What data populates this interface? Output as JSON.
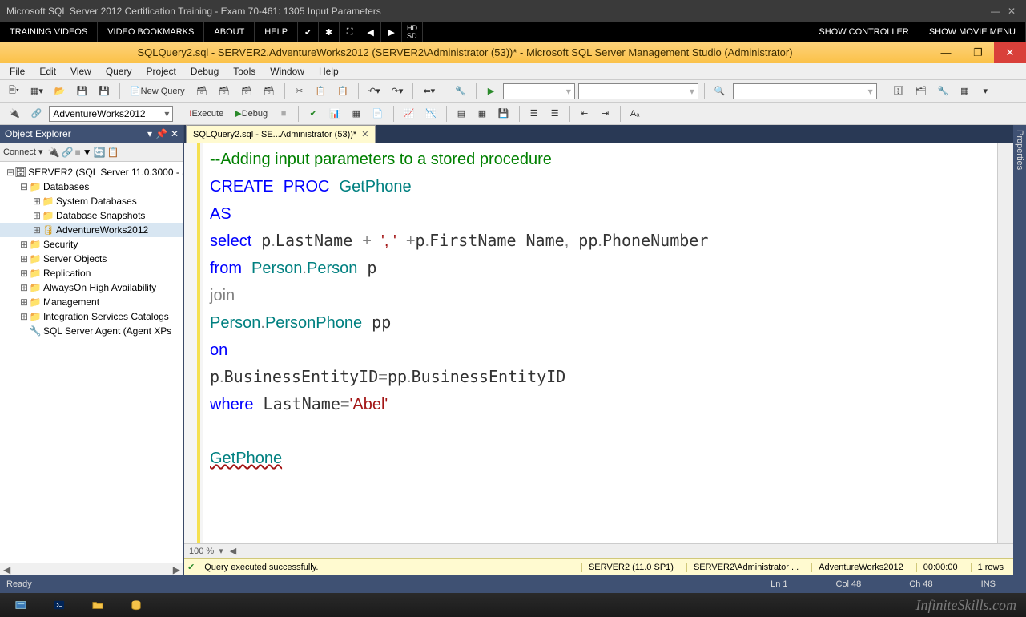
{
  "outerWindow": {
    "title": "Microsoft SQL Server 2012 Certification Training - Exam 70-461: 1305 Input Parameters"
  },
  "trainingBar": {
    "buttons": [
      "TRAINING VIDEOS",
      "VIDEO BOOKMARKS",
      "ABOUT",
      "HELP"
    ],
    "rightButtons": [
      "SHOW CONTROLLER",
      "SHOW MOVIE MENU"
    ]
  },
  "ssmsTitle": "SQLQuery2.sql - SERVER2.AdventureWorks2012 (SERVER2\\Administrator (53))* - Microsoft SQL Server Management Studio (Administrator)",
  "menuBar": [
    "File",
    "Edit",
    "View",
    "Query",
    "Project",
    "Debug",
    "Tools",
    "Window",
    "Help"
  ],
  "toolbar1": {
    "newQuery": "New Query"
  },
  "toolbar2": {
    "dbCombo": "AdventureWorks2012",
    "execute": "Execute",
    "debug": "Debug"
  },
  "objectExplorer": {
    "title": "Object Explorer",
    "connectLabel": "Connect ▾",
    "tree": {
      "server": "SERVER2 (SQL Server 11.0.3000 - S",
      "databases": "Databases",
      "sysdb": "System Databases",
      "snapshots": "Database Snapshots",
      "aw": "AdventureWorks2012",
      "security": "Security",
      "serverObjects": "Server Objects",
      "replication": "Replication",
      "alwaysOn": "AlwaysOn High Availability",
      "management": "Management",
      "isc": "Integration Services Catalogs",
      "agent": "SQL Server Agent (Agent XPs"
    }
  },
  "editor": {
    "tabLabel": "SQLQuery2.sql - SE...Administrator (53))*",
    "zoom": "100 %",
    "sqlComment": "--Adding input parameters to a stored procedure",
    "proc": "GetPhone",
    "literal": "'Abel'",
    "sep": "', '",
    "exec": "GetPhone"
  },
  "statusRow": {
    "msg": "Query executed successfully.",
    "server": "SERVER2 (11.0 SP1)",
    "user": "SERVER2\\Administrator ...",
    "db": "AdventureWorks2012",
    "time": "00:00:00",
    "rows": "1 rows"
  },
  "ssmsStatus": {
    "ready": "Ready",
    "ln": "Ln 1",
    "col": "Col 48",
    "ch": "Ch 48",
    "ins": "INS"
  },
  "propsTab": "Properties",
  "watermark": "InfiniteSkills.com"
}
